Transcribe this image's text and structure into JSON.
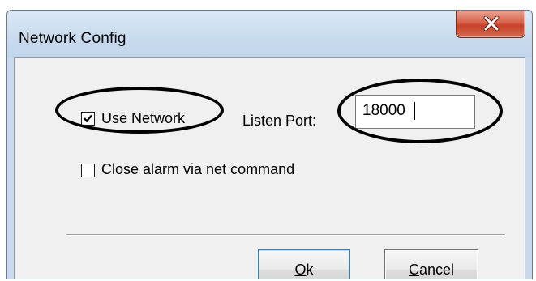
{
  "window": {
    "title": "Network Config",
    "close_glyph": "close-icon"
  },
  "form": {
    "use_network": {
      "label": "Use Network",
      "checked": true
    },
    "listen_port": {
      "label": "Listen Port:",
      "value": "18000"
    },
    "close_alarm": {
      "label": "Close alarm via net command",
      "checked": false
    }
  },
  "buttons": {
    "ok": {
      "mnemonic": "O",
      "rest": "k"
    },
    "cancel": {
      "mnemonic": "C",
      "rest": "ancel"
    }
  },
  "colors": {
    "titlebar": "#c9dbee",
    "client": "#f0f0f0",
    "close_button": "#c7412a",
    "annotation": "#000000"
  }
}
